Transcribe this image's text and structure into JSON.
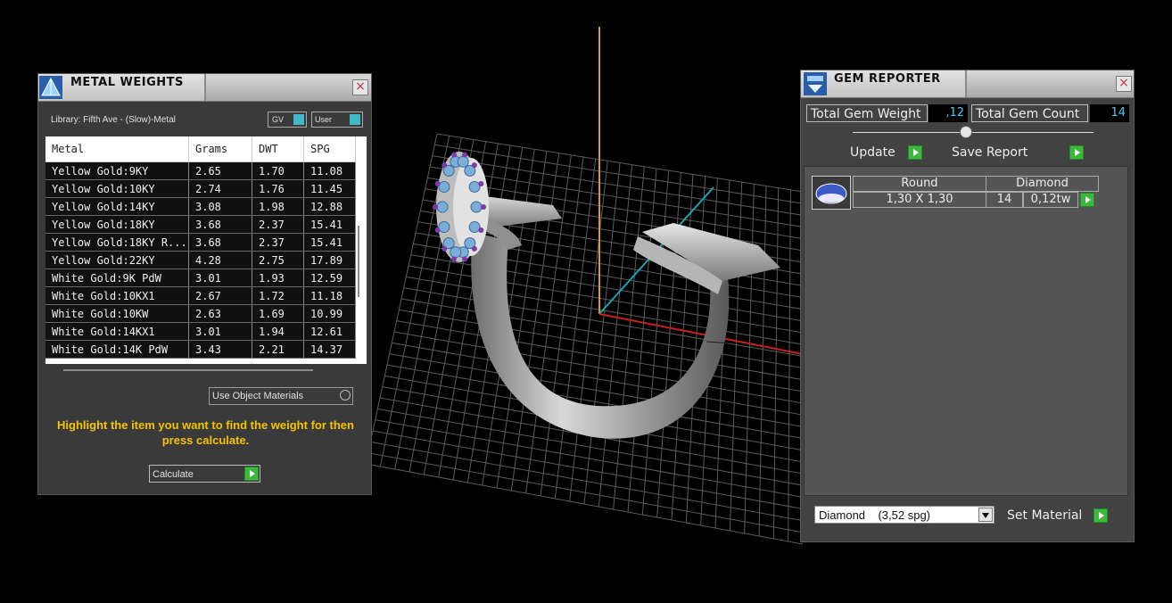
{
  "metal_panel": {
    "title": "METAL WEIGHTS",
    "library_label": "Library: Fifth Ave - (Slow)-Metal",
    "gv_label": "GV",
    "user_label": "User",
    "columns": [
      "Metal",
      "Grams",
      "DWT",
      "SPG"
    ],
    "rows": [
      [
        "Yellow Gold:9KY",
        "2.65",
        "1.70",
        "11.08"
      ],
      [
        "Yellow Gold:10KY",
        "2.74",
        "1.76",
        "11.45"
      ],
      [
        "Yellow Gold:14KY",
        "3.08",
        "1.98",
        "12.88"
      ],
      [
        "Yellow Gold:18KY",
        "3.68",
        "2.37",
        "15.41"
      ],
      [
        "Yellow Gold:18KY R...",
        "3.68",
        "2.37",
        "15.41"
      ],
      [
        "Yellow Gold:22KY",
        "4.28",
        "2.75",
        "17.89"
      ],
      [
        "White Gold:9K PdW",
        "3.01",
        "1.93",
        "12.59"
      ],
      [
        "White Gold:10KX1",
        "2.67",
        "1.72",
        "11.18"
      ],
      [
        "White Gold:10KW",
        "2.63",
        "1.69",
        "10.99"
      ],
      [
        "White Gold:14KX1",
        "3.01",
        "1.94",
        "12.61"
      ],
      [
        "White Gold:14K PdW",
        "3.43",
        "2.21",
        "14.37"
      ]
    ],
    "use_object_materials": "Use Object Materials",
    "instructions": "Highlight the item you want to find the weight for then press calculate.",
    "calculate_label": "Calculate"
  },
  "gem_panel": {
    "title": "GEM REPORTER",
    "total_weight_label": "Total Gem Weight",
    "total_weight_value": ",12",
    "total_count_label": "Total Gem Count",
    "total_count_value": "14",
    "update_label": "Update",
    "save_report_label": "Save Report",
    "gem_row": {
      "cut": "Round",
      "material": "Diamond",
      "size": "1,30 X 1,30",
      "count": "14",
      "weight": "0,12tw"
    },
    "material_select": "Diamond    (3,52 spg)",
    "set_material_label": "Set Material"
  },
  "colors": {
    "panel_bg": "#3a3a3a",
    "accent_cyan": "#4ec8f0",
    "action_green": "#3cb83c",
    "instruction_yellow": "#f5c400"
  }
}
